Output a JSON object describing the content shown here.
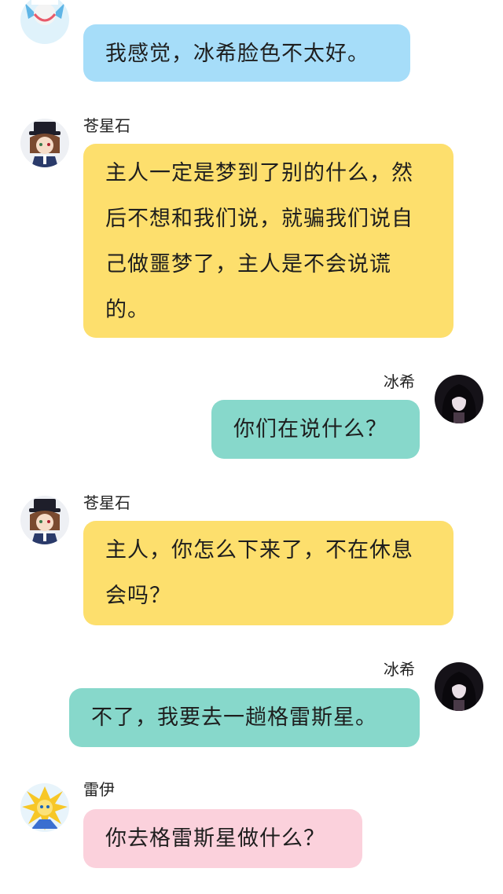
{
  "messages": [
    {
      "sender": "",
      "text": "我感觉，冰希脸色不太好。",
      "color": "#a6ddf9",
      "avatar": "blue-character-avatar"
    },
    {
      "sender": "苍星石",
      "text": "主人一定是梦到了别的什么，然后不想和我们说，就骗我们说自己做噩梦了，主人是不会说谎的。",
      "color": "#fddf6d",
      "avatar": "brown-hair-top-hat-avatar"
    },
    {
      "sender": "冰希",
      "text": "你们在说什么？",
      "color": "#87d8cb",
      "avatar": "dark-hair-girl-avatar"
    },
    {
      "sender": "苍星石",
      "text": "主人，你怎么下来了，不在休息会吗？",
      "color": "#fddf6d",
      "avatar": "brown-hair-top-hat-avatar"
    },
    {
      "sender": "冰希",
      "text": "不了，我要去一趟格雷斯星。",
      "color": "#87d8cb",
      "avatar": "dark-hair-girl-avatar"
    },
    {
      "sender": "雷伊",
      "text": "你去格雷斯星做什么？",
      "color": "#fbd1dc",
      "avatar": "yellow-spiky-avatar"
    }
  ]
}
